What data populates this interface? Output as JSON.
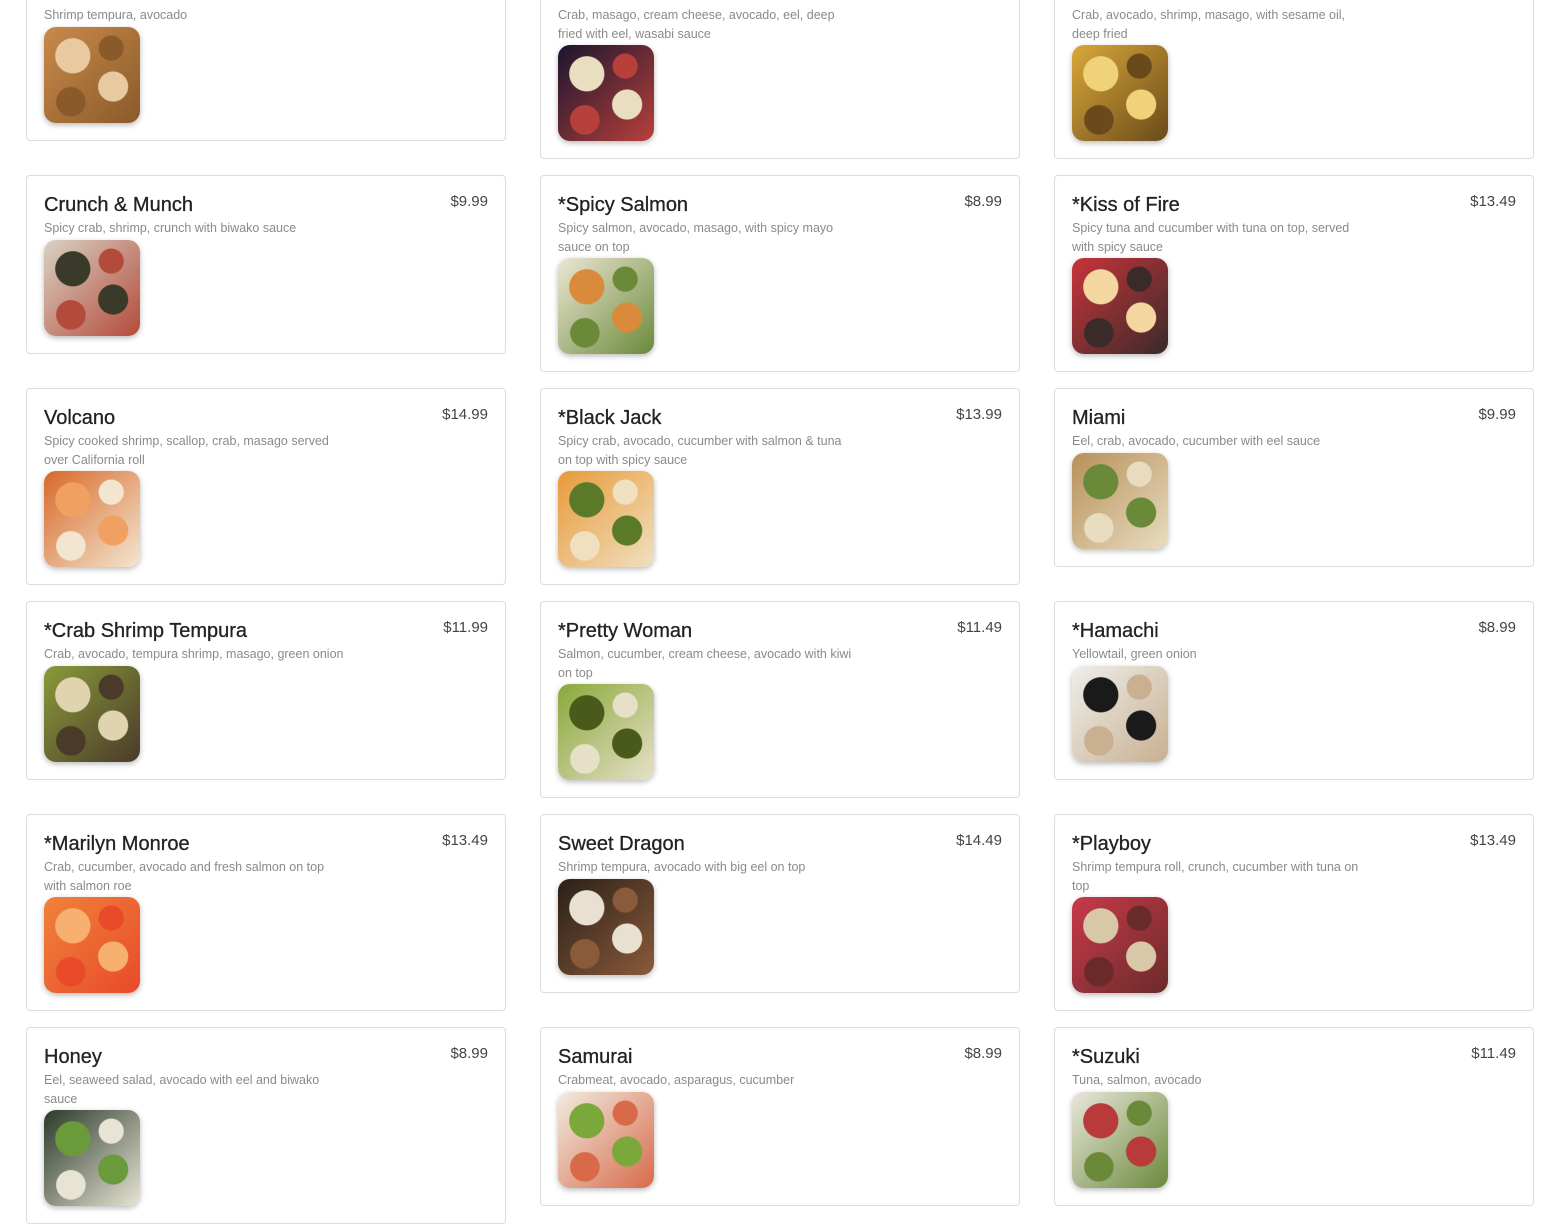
{
  "menu": {
    "items": [
      {
        "name": "",
        "price": "",
        "description": "Shrimp tempura, avocado",
        "image": "sushi-photo",
        "colors": [
          "#c98a4a",
          "#e8c9a0",
          "#8a5a2a"
        ]
      },
      {
        "name": "",
        "price": "",
        "description": "Crab, masago, cream cheese, avocado, eel, deep fried with eel, wasabi sauce",
        "image": "sushi-photo",
        "colors": [
          "#1a1530",
          "#e9dfc0",
          "#b8403a"
        ]
      },
      {
        "name": "",
        "price": "",
        "description": "Crab, avocado, shrimp, masago, with sesame oil, deep fried",
        "image": "sushi-photo",
        "colors": [
          "#d9a83a",
          "#f0d27a",
          "#6a4a1a"
        ]
      },
      {
        "name": "Crunch & Munch",
        "price": "$9.99",
        "description": "Spicy crab, shrimp, crunch with biwako sauce",
        "image": "sushi-photo",
        "colors": [
          "#d8d2c4",
          "#3a3a2a",
          "#b44a3a"
        ]
      },
      {
        "name": "*Spicy Salmon",
        "price": "$8.99",
        "description": "Spicy salmon, avocado, masago, with spicy mayo sauce on top",
        "image": "sushi-photo",
        "colors": [
          "#ede6d4",
          "#d98a3a",
          "#6a8a3a"
        ]
      },
      {
        "name": "*Kiss of Fire",
        "price": "$13.49",
        "description": "Spicy tuna and cucumber with tuna on top, served with spicy sauce",
        "image": "sushi-photo",
        "colors": [
          "#c8343a",
          "#f3d6a0",
          "#3a2a2a"
        ]
      },
      {
        "name": "Volcano",
        "price": "$14.99",
        "description": "Spicy cooked shrimp, scallop, crab, masago served over California roll",
        "image": "sushi-photo",
        "colors": [
          "#d8682a",
          "#f0a060",
          "#f3e6d0"
        ]
      },
      {
        "name": "*Black Jack",
        "price": "$13.99",
        "description": "Spicy crab, avocado, cucumber with salmon & tuna on top with spicy sauce",
        "image": "sushi-photo",
        "colors": [
          "#e89a3a",
          "#5a7a2a",
          "#f0e0c0"
        ]
      },
      {
        "name": "Miami",
        "price": "$9.99",
        "description": "Eel, crab, avocado, cucumber with eel sauce",
        "image": "sushi-photo",
        "colors": [
          "#b8905a",
          "#6a8a3a",
          "#e8dcc0"
        ]
      },
      {
        "name": "*Crab Shrimp Tempura",
        "price": "$11.99",
        "description": "Crab, avocado, tempura shrimp, masago, green onion",
        "image": "sushi-photo",
        "colors": [
          "#8a9a3a",
          "#e0d4b0",
          "#4a3a2a"
        ]
      },
      {
        "name": "*Pretty Woman",
        "price": "$11.49",
        "description": "Salmon, cucumber, cream cheese, avocado with kiwi on top",
        "image": "sushi-photo",
        "colors": [
          "#8aa83a",
          "#4a5a1a",
          "#e6e0c8"
        ]
      },
      {
        "name": "*Hamachi",
        "price": "$8.99",
        "description": "Yellowtail, green onion",
        "image": "sushi-photo",
        "colors": [
          "#eeeeea",
          "#1a1a1a",
          "#c8b090"
        ]
      },
      {
        "name": "*Marilyn Monroe",
        "price": "$13.49",
        "description": "Crab, cucumber, avocado and fresh salmon on top with salmon roe",
        "image": "sushi-photo",
        "colors": [
          "#f0823a",
          "#f8b070",
          "#e84a2a"
        ]
      },
      {
        "name": "Sweet Dragon",
        "price": "$14.49",
        "description": "Shrimp tempura, avocado with big eel on top",
        "image": "sushi-photo",
        "colors": [
          "#2a2018",
          "#e8e0d0",
          "#8a5a3a"
        ]
      },
      {
        "name": "*Playboy",
        "price": "$13.49",
        "description": "Shrimp tempura roll, crunch, cucumber with tuna on top",
        "image": "sushi-photo",
        "colors": [
          "#c83a4a",
          "#d8c8a8",
          "#6a2a2a"
        ]
      },
      {
        "name": "Honey",
        "price": "$8.99",
        "description": "Eel, seaweed salad, avocado with eel and biwako sauce",
        "image": "sushi-photo",
        "colors": [
          "#2a3a2a",
          "#6a9a3a",
          "#e8e4d4"
        ]
      },
      {
        "name": "Samurai",
        "price": "$8.99",
        "description": "Crabmeat, avocado, asparagus, cucumber",
        "image": "sushi-photo",
        "colors": [
          "#f0ece0",
          "#7aa83a",
          "#d86a4a"
        ]
      },
      {
        "name": "*Suzuki",
        "price": "$11.49",
        "description": "Tuna, salmon, avocado",
        "image": "sushi-photo",
        "colors": [
          "#eae6dc",
          "#b83a3a",
          "#6a8a3a"
        ]
      }
    ]
  }
}
